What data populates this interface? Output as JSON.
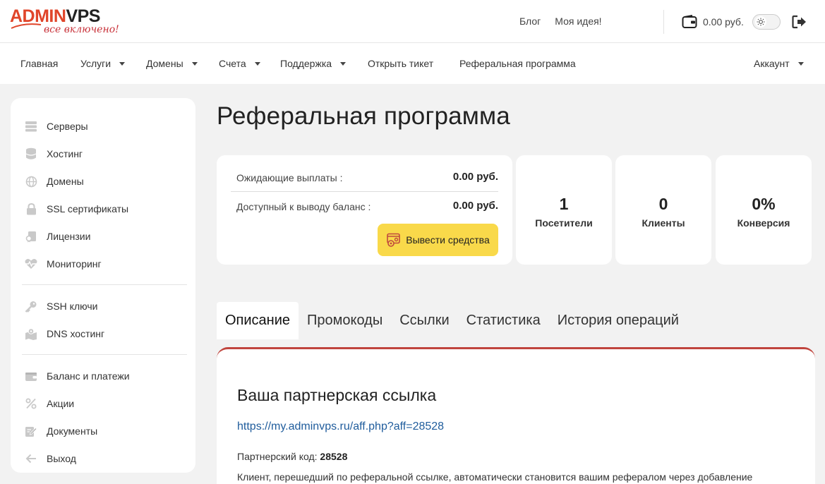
{
  "header": {
    "logo_admin": "ADMIN",
    "logo_vps": "VPS",
    "logo_tagline": "все включено!",
    "links": {
      "blog": "Блог",
      "idea": "Моя идея!"
    },
    "balance": "0.00 руб."
  },
  "nav": {
    "home": "Главная",
    "services": "Услуги",
    "domains": "Домены",
    "invoices": "Счета",
    "support": "Поддержка",
    "open_ticket": "Открыть тикет",
    "referral": "Реферальная программа",
    "account": "Аккаунт"
  },
  "sidebar": {
    "items": [
      {
        "label": "Серверы",
        "icon": "server-icon"
      },
      {
        "label": "Хостинг",
        "icon": "database-icon"
      },
      {
        "label": "Домены",
        "icon": "globe-icon"
      },
      {
        "label": "SSL сертификаты",
        "icon": "lock-icon"
      },
      {
        "label": "Лицензии",
        "icon": "license-icon"
      },
      {
        "label": "Мониторинг",
        "icon": "heartbeat-icon"
      },
      {
        "label": "SSH ключи",
        "icon": "key-icon"
      },
      {
        "label": "DNS хостинг",
        "icon": "map-icon"
      },
      {
        "label": "Баланс и платежи",
        "icon": "wallet-icon"
      },
      {
        "label": "Акции",
        "icon": "percent-icon"
      },
      {
        "label": "Документы",
        "icon": "document-icon"
      },
      {
        "label": "Выход",
        "icon": "arrow-left-icon"
      }
    ]
  },
  "page": {
    "title": "Реферальная программа",
    "pending_label": "Ожидающие выплаты :",
    "pending_value": "0.00 руб.",
    "available_label": "Доступный к выводу баланс :",
    "available_value": "0.00 руб.",
    "withdraw_button": "Вывести средства"
  },
  "stats": [
    {
      "value": "1",
      "label": "Посетители"
    },
    {
      "value": "0",
      "label": "Клиенты"
    },
    {
      "value": "0%",
      "label": "Конверсия"
    }
  ],
  "tabs": [
    "Описание",
    "Промокоды",
    "Ссылки",
    "Статистика",
    "История операций"
  ],
  "content": {
    "heading": "Ваша партнерская ссылка",
    "link": "https://my.adminvps.ru/aff.php?aff=28528",
    "code_label": "Партнерский код:",
    "code_value": "28528",
    "description": "Клиент, перешедший по реферальной ссылке, автоматически становится вашим рефералом через добавление"
  },
  "colors": {
    "accent_red": "#e0452a",
    "button_yellow": "#f9d94a",
    "tab_border": "#c0453e",
    "link_blue": "#1f5c9c"
  }
}
